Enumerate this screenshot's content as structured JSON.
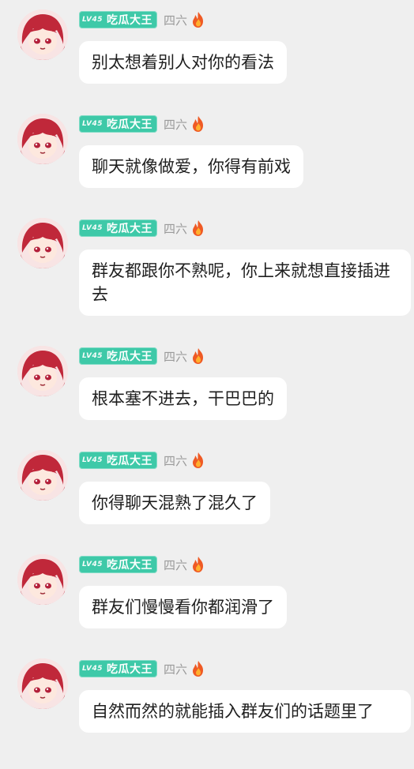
{
  "messages": [
    {
      "badge_level": "LV45",
      "badge_title": "吃瓜大王",
      "nickname": "四六",
      "text": "别太想着别人对你的看法"
    },
    {
      "badge_level": "LV45",
      "badge_title": "吃瓜大王",
      "nickname": "四六",
      "text": "聊天就像做爱，你得有前戏"
    },
    {
      "badge_level": "LV45",
      "badge_title": "吃瓜大王",
      "nickname": "四六",
      "text": "群友都跟你不熟呢，你上来就想直接插进去"
    },
    {
      "badge_level": "LV45",
      "badge_title": "吃瓜大王",
      "nickname": "四六",
      "text": "根本塞不进去，干巴巴的"
    },
    {
      "badge_level": "LV45",
      "badge_title": "吃瓜大王",
      "nickname": "四六",
      "text": "你得聊天混熟了混久了"
    },
    {
      "badge_level": "LV45",
      "badge_title": "吃瓜大王",
      "nickname": "四六",
      "text": "群友们慢慢看你都润滑了"
    },
    {
      "badge_level": "LV45",
      "badge_title": "吃瓜大王",
      "nickname": "四六",
      "text": "自然而然的就能插入群友们的话题里了"
    }
  ],
  "colors": {
    "background": "#efefef",
    "badge": "#3ec9a8",
    "nickname": "#9a9a9a",
    "bubble": "#ffffff"
  },
  "icons": {
    "avatar": "anime-girl-red-hair-avatar",
    "flame": "fire-icon"
  }
}
